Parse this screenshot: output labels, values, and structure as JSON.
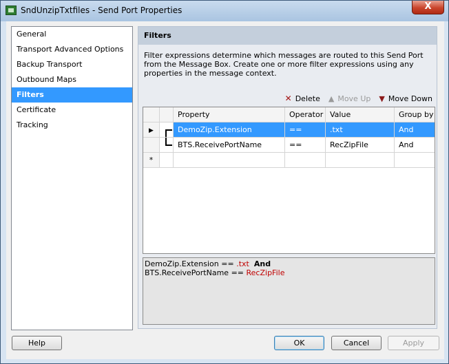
{
  "window": {
    "title": "SndUnzipTxtfiles - Send Port Properties",
    "close_label": "X"
  },
  "nav": {
    "items": [
      {
        "label": "General"
      },
      {
        "label": "Transport Advanced Options"
      },
      {
        "label": "Backup Transport"
      },
      {
        "label": "Outbound Maps"
      },
      {
        "label": "Filters",
        "selected": true
      },
      {
        "label": "Certificate"
      },
      {
        "label": "Tracking"
      }
    ]
  },
  "filters": {
    "header": "Filters",
    "description": "Filter expressions determine which messages are routed to this Send Port from the Message Box. Create one or more filter expressions using any properties in the message context.",
    "toolbar": {
      "delete_label": "Delete",
      "move_up_label": "Move Up",
      "move_down_label": "Move Down"
    },
    "columns": {
      "property": "Property",
      "operator": "Operator",
      "value": "Value",
      "group_by": "Group by"
    },
    "rows": [
      {
        "property": "DemoZip.Extension",
        "operator": "==",
        "value": ".txt",
        "group_by": "And",
        "selected": true
      },
      {
        "property": "BTS.ReceivePortName",
        "operator": "==",
        "value": "RecZipFile",
        "group_by": "And",
        "selected": false
      }
    ],
    "new_row_indicator": "*",
    "current_row_indicator": "▶",
    "summary": {
      "line1": {
        "prop": "DemoZip.Extension",
        "op": "==",
        "val": ".txt",
        "group": "And"
      },
      "line2": {
        "prop": "BTS.ReceivePortName",
        "op": "==",
        "val": "RecZipFile"
      }
    }
  },
  "buttons": {
    "help": "Help",
    "ok": "OK",
    "cancel": "Cancel",
    "apply": "Apply"
  }
}
